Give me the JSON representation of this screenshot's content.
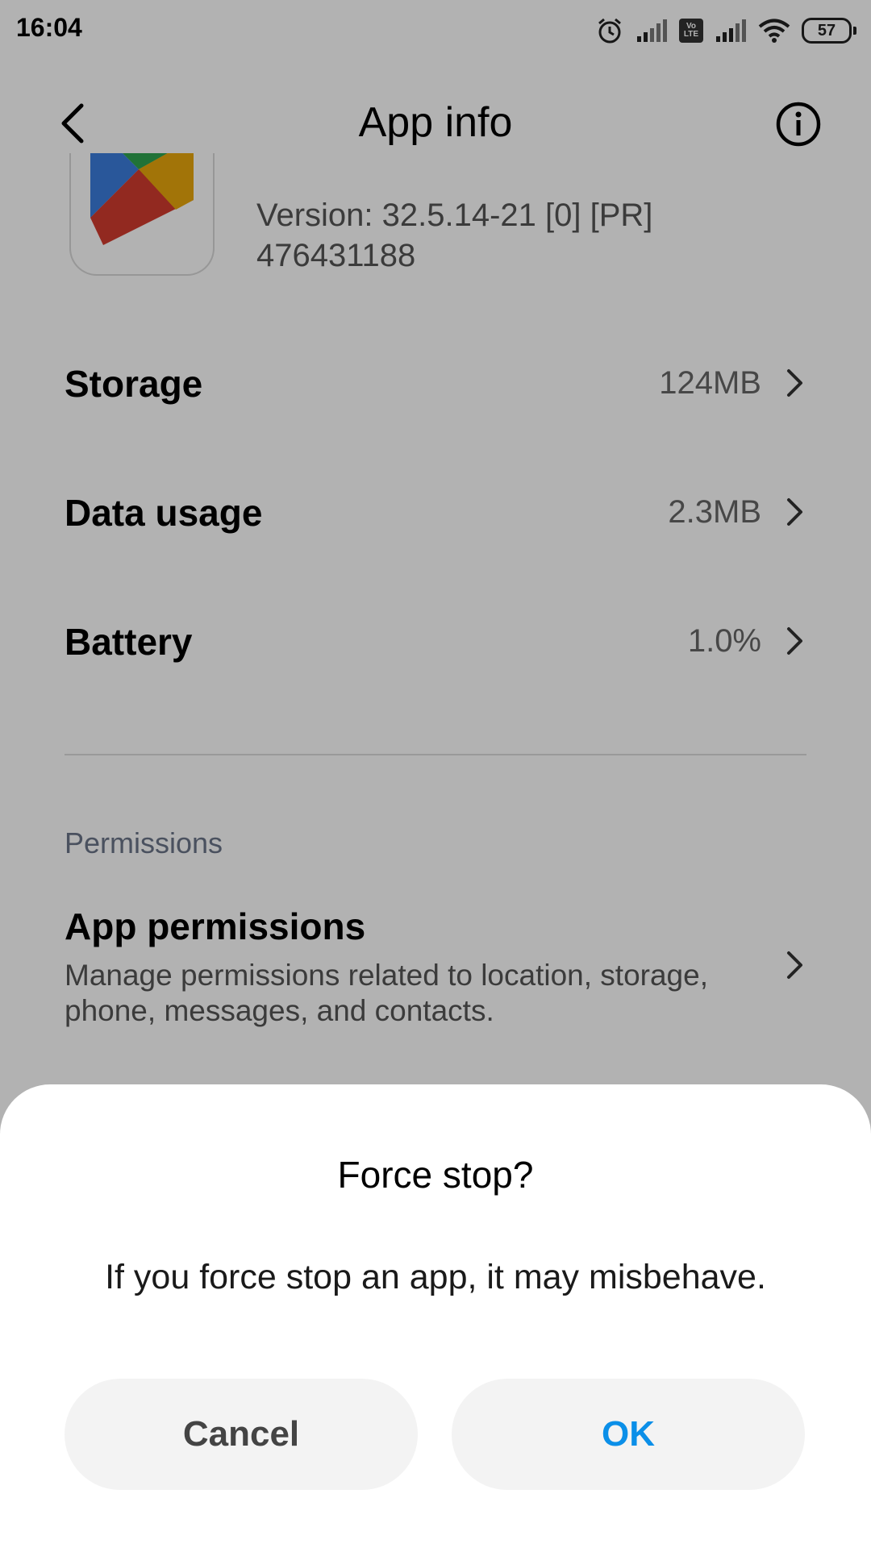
{
  "status_bar": {
    "time": "16:04",
    "battery": "57",
    "lte_badge": "Vo LTE",
    "icons": [
      "alarm-icon",
      "signal-icon",
      "volte-icon",
      "signal-icon",
      "wifi-icon",
      "battery-icon"
    ]
  },
  "header": {
    "title": "App info",
    "back_icon": "chevron-left-icon",
    "info_icon": "info-icon"
  },
  "app": {
    "icon": "google-play-icon",
    "version_line1": "Version: 32.5.14-21 [0] [PR]",
    "version_line2": "476431188"
  },
  "rows": [
    {
      "label": "Storage",
      "value": "124MB"
    },
    {
      "label": "Data usage",
      "value": "2.3MB"
    },
    {
      "label": "Battery",
      "value": "1.0%"
    }
  ],
  "permissions": {
    "section_label": "Permissions",
    "title": "App permissions",
    "description": "Manage permissions related to location, storage, phone, messages, and contacts."
  },
  "dialog": {
    "title": "Force stop?",
    "message": "If you force stop an app, it may misbehave.",
    "cancel_label": "Cancel",
    "ok_label": "OK"
  },
  "colors": {
    "accent": "#0b8fe8",
    "section_label": "#6b7488",
    "button_bg": "#f3f3f3"
  }
}
